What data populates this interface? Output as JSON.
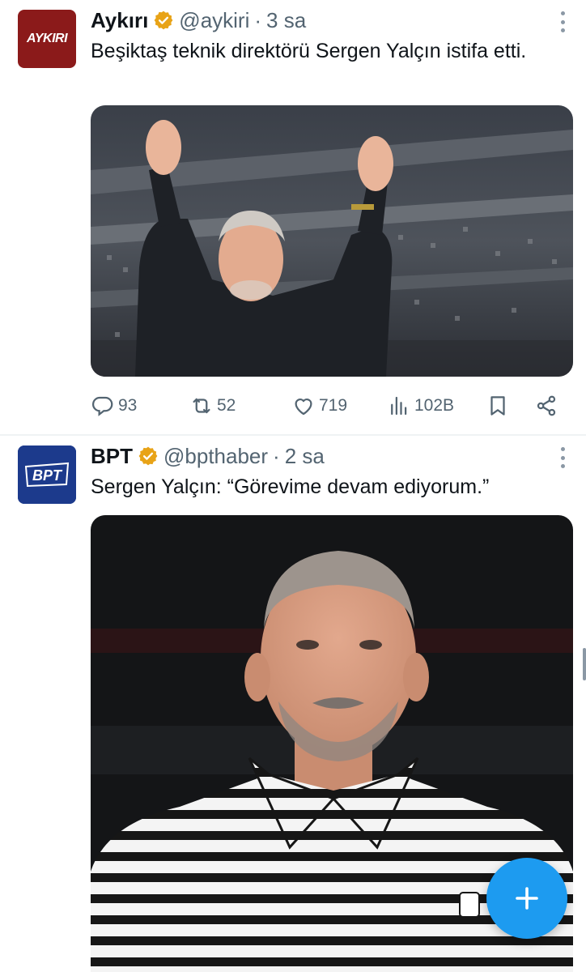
{
  "tweets": [
    {
      "name": "Aykırı",
      "handle": "@aykiri",
      "separator": "·",
      "time": "3 sa",
      "avatar_text": "AYKIRI",
      "text": "Beşiktaş teknik direktörü Sergen Yalçın istifa etti.",
      "metrics": {
        "replies": "93",
        "retweets": "52",
        "likes": "719",
        "views": "102B"
      }
    },
    {
      "name": "BPT",
      "handle": "@bpthaber",
      "separator": "·",
      "time": "2 sa",
      "avatar_text": "BPT",
      "text": "Sergen Yalçın: “Görevime devam ediyorum.”"
    }
  ],
  "colors": {
    "accent": "#1d9bf0",
    "verified": "#e8a317",
    "secondary_text": "#536471"
  },
  "icons": {
    "reply": "reply-icon",
    "retweet": "retweet-icon",
    "like": "heart-icon",
    "views": "views-icon",
    "bookmark": "bookmark-icon",
    "share": "share-icon",
    "compose": "plus-icon"
  }
}
